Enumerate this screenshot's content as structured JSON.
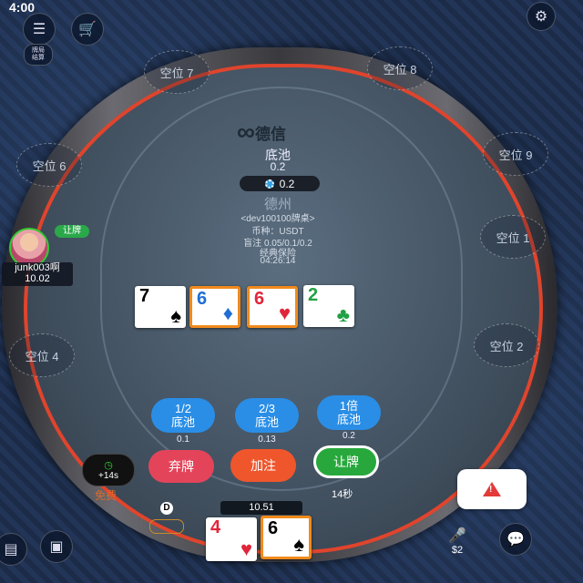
{
  "status": {
    "time": "4:00"
  },
  "icons": {
    "menu": "menu-icon",
    "shop": "cart-icon",
    "settings": "settings-icon",
    "history": "history-icon",
    "chat": "chat-icon",
    "mic": "microphone-icon",
    "warn": "alert-icon"
  },
  "top_left_badge": "牌局\n结算",
  "seats": {
    "s7": "空位 7",
    "s8": "空位 8",
    "s6": "空位 6",
    "s9": "空位 9",
    "s1": "空位 1",
    "s4": "空位 4",
    "s2": "空位 2"
  },
  "brand": {
    "mark": "∞",
    "name": "德信"
  },
  "pot": {
    "label": "底池",
    "value": "0.2",
    "pill": "0.2"
  },
  "table_info": {
    "game": "德州",
    "table": "<dev100100牌桌>",
    "currency": "币种：USDT",
    "blinds": "盲注 0.05/0.1/0.2",
    "insurance": "经典保险",
    "clock": "04:26:14"
  },
  "board": [
    {
      "rank": "7",
      "suit": "♠",
      "color": "black",
      "highlight": false
    },
    {
      "rank": "6",
      "suit": "♦",
      "color": "blue",
      "highlight": true
    },
    {
      "rank": "6",
      "suit": "♥",
      "color": "red",
      "highlight": true
    },
    {
      "rank": "2",
      "suit": "♣",
      "color": "green",
      "highlight": false
    }
  ],
  "bet_presets": [
    {
      "label1": "1/2",
      "label2": "底池",
      "value": "0.1"
    },
    {
      "label1": "2/3",
      "label2": "底池",
      "value": "0.13"
    },
    {
      "label1": "1倍",
      "label2": "底池",
      "value": "0.2"
    }
  ],
  "actions": {
    "fold": "弃牌",
    "raise": "加注",
    "check": "让牌",
    "countdown": "14秒"
  },
  "timebank": {
    "label": "+14s",
    "free": "免费"
  },
  "player": {
    "name": "junk003啊",
    "stack": "10.02",
    "action_badge": "让牌"
  },
  "hero": {
    "stack": "10.51",
    "dealer": "D",
    "cards": [
      {
        "rank": "4",
        "suit": "♥",
        "color": "red"
      },
      {
        "rank": "6",
        "suit": "♠",
        "color": "black"
      }
    ]
  },
  "bottom": {
    "mic_amount": "$2"
  },
  "colors": {
    "rail_red": "#e0442c",
    "action_blue": "#2a8ee6",
    "fold_red": "#e4445a",
    "raise_orange": "#f0562c",
    "check_green": "#28a83c"
  }
}
